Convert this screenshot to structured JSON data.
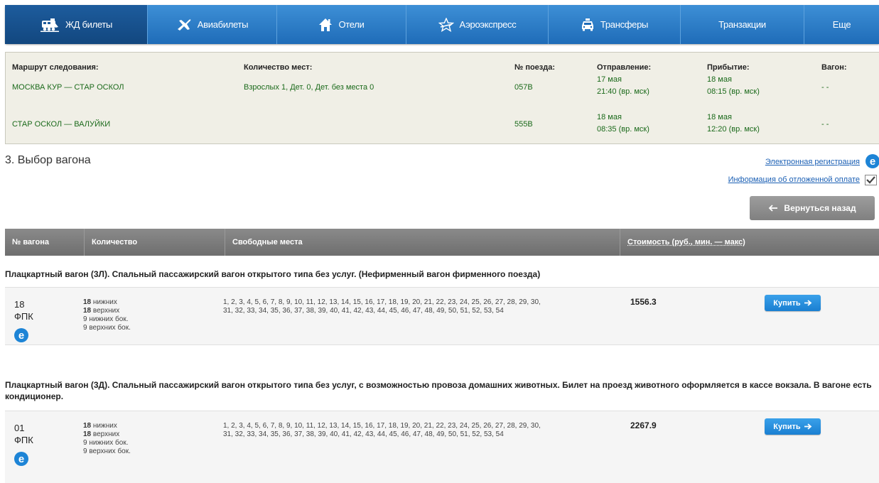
{
  "nav": {
    "items": [
      {
        "label": "ЖД билеты",
        "icon": "train-icon",
        "active": true
      },
      {
        "label": "Авиабилеты",
        "icon": "plane-icon"
      },
      {
        "label": "Отели",
        "icon": "home-icon"
      },
      {
        "label": "Аэроэкспресс",
        "icon": "star-icon"
      },
      {
        "label": "Трансферы",
        "icon": "car-icon"
      },
      {
        "label": "Транзакции",
        "icon": ""
      },
      {
        "label": "Еще",
        "icon": ""
      }
    ]
  },
  "route": {
    "headers": {
      "route": "Маршрут следования:",
      "seats": "Количество мест:",
      "train": "№ поезда:",
      "departure": "Отправление:",
      "arrival": "Прибытие:",
      "car": "Вагон:"
    },
    "legs": [
      {
        "route": "МОСКВА КУР — СТАР ОСКОЛ",
        "seats": "Взрослых 1, Дет. 0, Дет. без места 0",
        "train": "057В",
        "dep_date": "17 мая",
        "dep_time": "21:40 (вр. мск)",
        "arr_date": "18 мая",
        "arr_time": "08:15 (вр. мск)",
        "car": "- -"
      },
      {
        "route": "СТАР ОСКОЛ — ВАЛУЙКИ",
        "seats": "",
        "train": "555В",
        "dep_date": "18 мая",
        "dep_time": "08:35 (вр. мск)",
        "arr_date": "18 мая",
        "arr_time": "12:20 (вр. мск)",
        "car": "- -"
      }
    ]
  },
  "section": {
    "title": "3. Выбор вагона",
    "eregistration_link": "Электронная регистрация",
    "deferred_payment_link": "Информация об отложенной оплате",
    "back_button": "Вернуться назад"
  },
  "table": {
    "headers": {
      "car_no": "№ вагона",
      "quantity": "Количество",
      "free_seats": "Свободные места",
      "price": "Стоимость (руб., мин. — макс)"
    }
  },
  "wagons": [
    {
      "title": "Плацкартный вагон (3Л). Спальный пассажирский вагон открытого типа без услуг. (Нефирменный вагон фирменного поезда)",
      "number": "18",
      "carrier": "ФПК",
      "counts": [
        {
          "n": "18",
          "label": "нижних"
        },
        {
          "n": "18",
          "label": "верхних"
        },
        {
          "n": "9",
          "label": "нижних бок."
        },
        {
          "n": "9",
          "label": "верхних бок."
        }
      ],
      "seats_line1": "1, 2, 3, 4, 5, 6, 7, 8, 9, 10, 11, 12, 13, 14, 15, 16, 17, 18, 19, 20, 21, 22, 23, 24, 25, 26, 27, 28, 29, 30,",
      "seats_line2": "31, 32, 33, 34, 35, 36, 37, 38, 39, 40, 41, 42, 43, 44, 45, 46, 47, 48, 49, 50, 51, 52, 53, 54",
      "price": "1556.3",
      "buy_label": "Купить"
    },
    {
      "title": "Плацкартный вагон (3Д). Спальный пассажирский вагон открытого типа без услуг, с возможностью провоза домашних животных. Билет на проезд животного оформляется в кассе вокзала. В вагоне есть кондиционер.",
      "number": "01",
      "carrier": "ФПК",
      "counts": [
        {
          "n": "18",
          "label": "нижних"
        },
        {
          "n": "18",
          "label": "верхних"
        },
        {
          "n": "9",
          "label": "нижних бок."
        },
        {
          "n": "9",
          "label": "верхних бок."
        }
      ],
      "seats_line1": "1, 2, 3, 4, 5, 6, 7, 8, 9, 10, 11, 12, 13, 14, 15, 16, 17, 18, 19, 20, 21, 22, 23, 24, 25, 26, 27, 28, 29, 30,",
      "seats_line2": "31, 32, 33, 34, 35, 36, 37, 38, 39, 40, 41, 42, 43, 44, 45, 46, 47, 48, 49, 50, 51, 52, 53, 54",
      "price": "2267.9",
      "buy_label": "Купить"
    }
  ],
  "colors": {
    "nav_blue": "#2a7bc6",
    "nav_active": "#174f8c",
    "route_bg": "#f0efe6",
    "route_text": "#1b6a1b",
    "buy_button": "#1a7fd1",
    "back_button": "#8c8c8c"
  }
}
